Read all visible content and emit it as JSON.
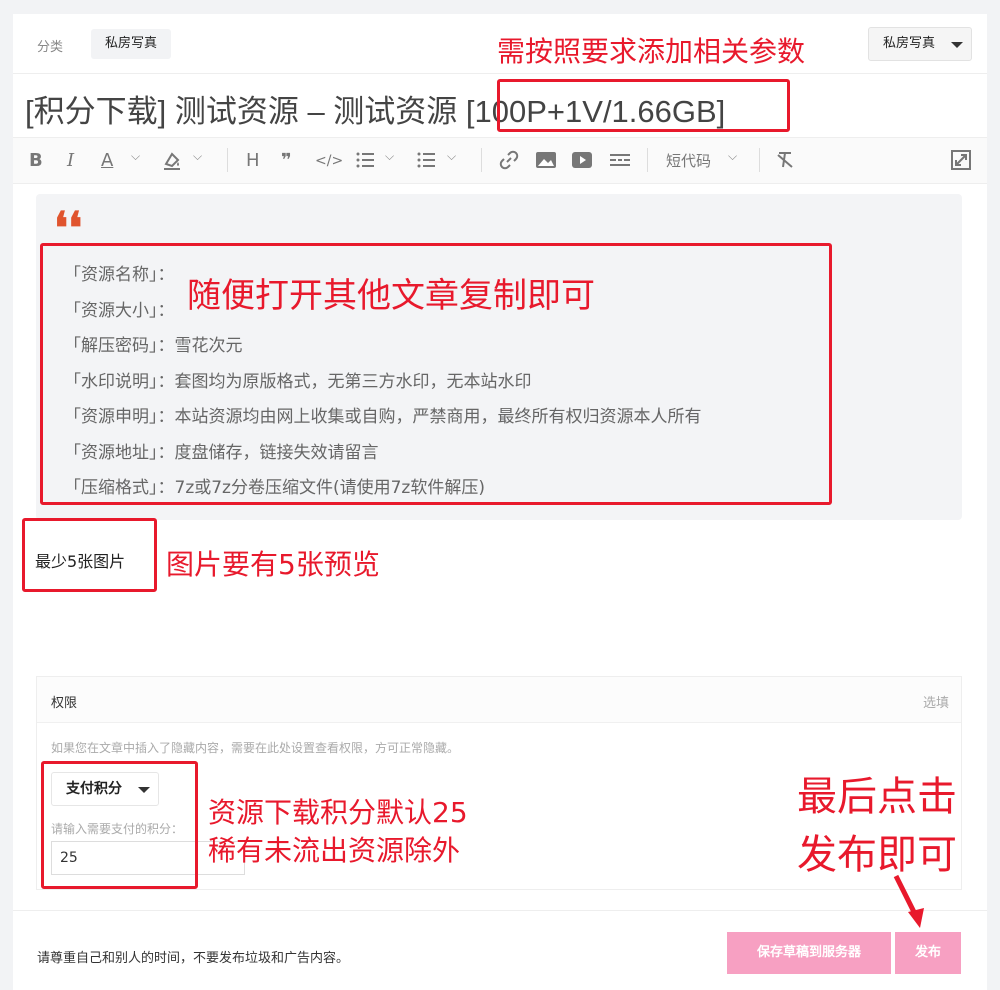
{
  "category": {
    "label": "分类",
    "tag": "私房写真",
    "select": "私房写真"
  },
  "title": "[积分下载] 测试资源 – 测试资源 [100P+1V/1.66GB]",
  "toolbar": {
    "bold": "B",
    "italic": "I",
    "font_color": "A",
    "heading": "H",
    "quote": "❞",
    "code": "</>",
    "shortcode": "短代码",
    "chevron": "⌵"
  },
  "quote": {
    "mark": "❛❛",
    "lines": [
      "「资源名称」：",
      "「资源大小」：",
      "「解压密码」：雪花次元",
      "「水印说明」：套图均为原版格式，无第三方水印，无本站水印",
      "「资源申明」：本站资源均由网上收集或自购，严禁商用，最终所有权归资源本人所有",
      "「资源地址」：度盘储存，链接失效请留言",
      "「压缩格式」：7z或7z分卷压缩文件(请使用7z软件解压)"
    ]
  },
  "body_text": "最少5张图片",
  "permission": {
    "title": "权限",
    "option": "选填",
    "description": "如果您在文章中插入了隐藏内容，需要在此处设置查看权限，方可正常隐藏。",
    "pay_type": "支付积分",
    "pay_label": "请输入需要支付的积分：",
    "pay_value": "25"
  },
  "footer": {
    "note": "请尊重自己和别人的时间，不要发布垃圾和广告内容。",
    "draft_button": "保存草稿到服务器",
    "publish_button": "发布"
  },
  "annotations": {
    "params": "需按照要求添加相关参数",
    "copy": "随便打开其他文章复制即可",
    "images": "图片要有5张预览",
    "points_1": "资源下载积分默认25",
    "points_2": "稀有未流出资源除外",
    "final_1": "最后点击",
    "final_2": "发布即可"
  },
  "colors": {
    "annotation": "#e8192c",
    "button": "#f7a0c2",
    "quote_mark": "#e0542e"
  }
}
